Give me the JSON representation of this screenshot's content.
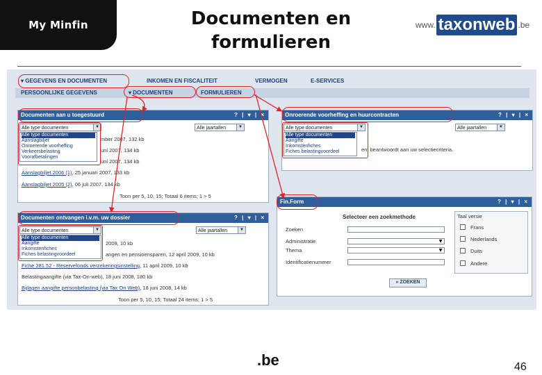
{
  "header": {
    "brand": "My Minfin",
    "title_line1": "Documenten en",
    "title_line2": "formulieren",
    "logo_www": "www.",
    "logo_name": "taxonweb",
    "logo_be": ".be"
  },
  "nav": {
    "level1": [
      "▾ GEGEVENS EN DOCUMENTEN",
      "INKOMEN EN FISCALITEIT",
      "VERMOGEN",
      "E-SERVICES"
    ],
    "level2": [
      "PERSOONLIJKE GEGEVENS",
      "▾ DOCUMENTEN",
      "FORMULIEREN"
    ]
  },
  "panel_sent": {
    "title": "Documenten aan u toegestuurd",
    "tools": "? | ▾ | ×",
    "type_select": "Alle type documenten",
    "year_select": "Alle jaartallen",
    "type_options": [
      "Alle type documenten",
      "Aanslagbiljet",
      "Onroerende voorheffing",
      "Verkeersbelasting",
      "Voorafbetalingen"
    ],
    "lines": [
      "mber 2007, 132 kb",
      "uni 2007, 134 kb",
      "uni 2007, 134 kb"
    ],
    "link1": "Aanslagbiljet 2006 (1)",
    "link1_rest": ", 25 januari 2007, 133 kb",
    "link2": "Aanslagbiljet 2005 (2)",
    "link2_rest": ", 06 juli 2007, 134 kb",
    "footer": "Toon per 5, 10, 15; Totaal 6 items;   1 > 5"
  },
  "panel_property": {
    "title": "Onroerende voorheffing en huurcontracten",
    "tools": "? | ▾ | ×",
    "type_select": "Alle type documenten",
    "year_select": "Alle jaartallen",
    "type_options": [
      "Alle type documenten",
      "Aangifte",
      "Inkomstenfiches",
      "Fiches belastingvoordeel"
    ],
    "message": "ent beantwoordt aan uw selectiecriteria."
  },
  "panel_received": {
    "title": "Documenten ontvangen i.v.m. uw dossier",
    "tools": "? | ▾ | ×",
    "type_select": "Alle type documenten",
    "year_select": "Alle jaartallen",
    "type_options": [
      "Alle type documenten",
      "Aangifte",
      "Inkomstenfiches",
      "Fiches belastingvoordeel"
    ],
    "line1": "2009, 10 kb",
    "line2": "angen en pensioensparen, 12 april 2009, 10 kb",
    "link3": "Fiche 281.52 - Reservefonds verzekeringsinstelling",
    "link3_rest": ", 11 april 2009, 10 kb",
    "line4": "Belastingaangifte (via Tax-On-web), 18 juni 2008, 180 kb",
    "link5": "Bijlagen aangifte personbelasting (via Tax On Web)",
    "link5_rest": ", 18 juni 2008, 14 kb",
    "footer": "Toon per 5, 10, 15; Totaal 24 items;   1 > 5"
  },
  "panel_finform": {
    "title": "Fin.Form",
    "tools": "? | ▾ | ×",
    "heading": "Selecteer een zoekmethode",
    "search_label": "Zoeken",
    "admin_label": "Administratie",
    "theme_label": "Thema",
    "id_label": "Identificatienummer",
    "button": "» ZOEKEN",
    "lang_title": "Taal versie",
    "langs": [
      "Frans",
      "Nederlands",
      "Duits",
      "Andere"
    ]
  },
  "footer": {
    "be_logo": ".be",
    "page_number": "46"
  }
}
